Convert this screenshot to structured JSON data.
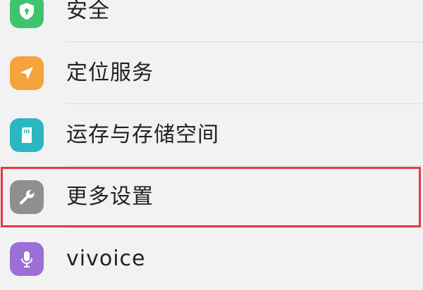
{
  "settings_list": {
    "items": [
      {
        "label": "安全",
        "icon": "shield-icon",
        "color": "#3ec46d"
      },
      {
        "label": "定位服务",
        "icon": "location-arrow-icon",
        "color": "#f5a33b"
      },
      {
        "label": "运存与存储空间",
        "icon": "sd-card-icon",
        "color": "#2bb6c2"
      },
      {
        "label": "更多设置",
        "icon": "wrench-icon",
        "color": "#8f8f8f"
      },
      {
        "label": "vivoice",
        "icon": "microphone-icon",
        "color": "#9b6fd6"
      }
    ],
    "highlighted_item": "更多设置",
    "highlight_color": "#e53945"
  }
}
